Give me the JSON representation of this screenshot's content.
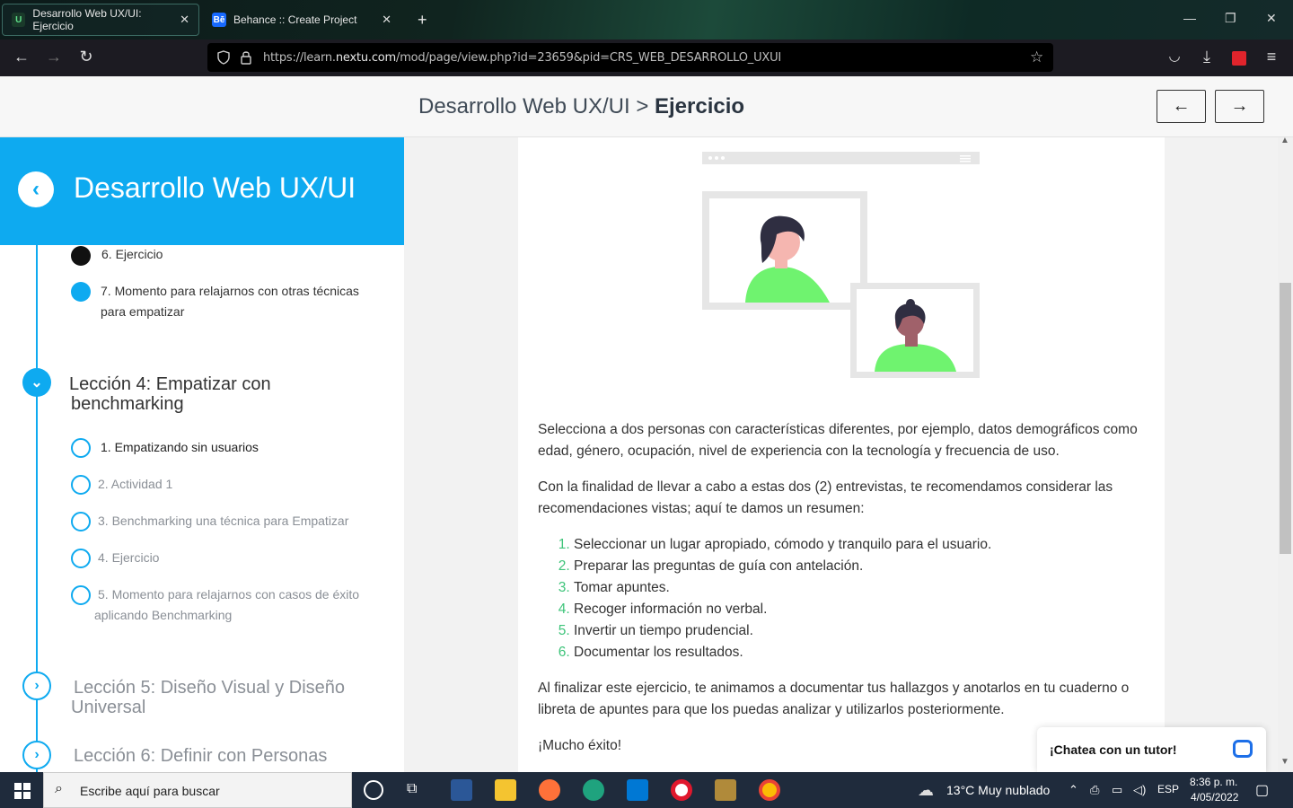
{
  "browser": {
    "tabs": [
      {
        "title": "Desarrollo Web UX/UI: Ejercicio",
        "favicon": "U",
        "active": true
      },
      {
        "title": "Behance :: Create Project",
        "favicon": "Bē",
        "active": false
      }
    ],
    "url_prefix": "https://learn.",
    "url_domain": "nextu.com",
    "url_path": "/mod/page/view.php?id=23659&pid=CRS_WEB_DESARROLLO_UXUI"
  },
  "header": {
    "crumb_course": "Desarrollo Web UX/UI",
    "crumb_sep": ">",
    "crumb_page": "Ejercicio",
    "prev_icon": "←",
    "next_icon": "→"
  },
  "sidebar": {
    "title": "Desarrollo Web UX/UI",
    "back_icon": "‹",
    "top_items": [
      {
        "line1": "6. Ejercicio",
        "line2": ""
      },
      {
        "line1": "7. Momento para relajarnos con otras técnicas",
        "line2": "para empatizar"
      }
    ],
    "lesson4": {
      "line1": "Lección 4: Empatizar con",
      "line2": "benchmarking",
      "icon": "⌄",
      "items": [
        {
          "line1": "1. Empatizando sin usuarios",
          "line2": ""
        },
        {
          "line1": "2. Actividad 1",
          "line2": ""
        },
        {
          "line1": "3. Benchmarking una técnica para Empatizar",
          "line2": ""
        },
        {
          "line1": "4. Ejercicio",
          "line2": ""
        },
        {
          "line1": "5. Momento para relajarnos con casos de éxito",
          "line2": "aplicando Benchmarking"
        }
      ]
    },
    "lesson5": {
      "line1": "Lección 5: Diseño Visual y Diseño",
      "line2": "Universal",
      "icon": "›"
    },
    "lesson6": {
      "line1": "Lección 6: Definir con Personas",
      "icon": "›"
    }
  },
  "content": {
    "p1": "Selecciona a dos personas con características diferentes, por ejemplo, datos demográficos como edad, género, ocupación, nivel de experiencia con la tecnología y frecuencia de uso.",
    "p2": "Con la finalidad de llevar a cabo a estas dos (2) entrevistas, te recomendamos considerar las recomendaciones vistas; aquí te damos un resumen:",
    "list": [
      "Seleccionar un lugar apropiado, cómodo y tranquilo para el usuario.",
      "Preparar las preguntas de guía con antelación.",
      "Tomar apuntes.",
      "Recoger información no verbal.",
      "Invertir un tiempo prudencial.",
      "Documentar los resultados."
    ],
    "p3": "Al finalizar este ejercicio, te animamos a documentar tus hallazgos y anotarlos en tu cuaderno o libreta de apuntes para que los puedas analizar y utilizarlos posteriormente.",
    "p4": "¡Mucho éxito!"
  },
  "chat": {
    "label": "¡Chatea con un tutor!"
  },
  "taskbar": {
    "search_placeholder": "Escribe aquí para buscar",
    "weather": "13°C  Muy nublado",
    "lang": "ESP",
    "time": "8:36 p. m.",
    "date": "4/05/2022"
  },
  "colors": {
    "accent": "#0eaaf0",
    "list_marker": "#3ec47a",
    "figure_green": "#6ff36f"
  }
}
